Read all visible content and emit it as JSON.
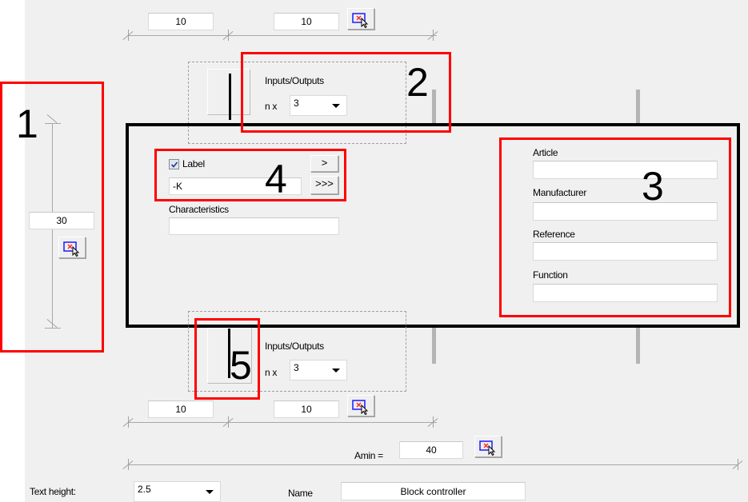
{
  "top_dimensions": {
    "left_value": "10",
    "right_value": "10"
  },
  "top_io": {
    "title": "Inputs/Outputs",
    "count_prefix": "n x",
    "count_value": "3"
  },
  "height_dimension": {
    "value": "30"
  },
  "label_section": {
    "checkbox_label": "Label",
    "checked": true,
    "label_value": "-K",
    "next_button": ">",
    "all_button": ">>>",
    "characteristics_label": "Characteristics",
    "characteristics_value": ""
  },
  "properties": {
    "article_label": "Article",
    "article_value": "",
    "manufacturer_label": "Manufacturer",
    "manufacturer_value": "",
    "reference_label": "Reference",
    "reference_value": "",
    "function_label": "Function",
    "function_value": ""
  },
  "bottom_io": {
    "title": "Inputs/Outputs",
    "count_prefix": "n x",
    "count_value": "3"
  },
  "bottom_dimensions": {
    "left_value": "10",
    "right_value": "10"
  },
  "amin": {
    "label": "Amin =",
    "value": "40"
  },
  "footer": {
    "text_height_label": "Text height:",
    "text_height_value": "2.5",
    "name_label": "Name",
    "name_value": "Block controller"
  },
  "annotations": {
    "callout_1": "1",
    "callout_2": "2",
    "callout_3": "3",
    "callout_4": "4",
    "callout_5": "5",
    "color": "#ff0000"
  },
  "icons": {
    "pick_button": "pick-from-drawing-icon",
    "io_preview": "io-bar-icon",
    "combo_arrow": "dropdown-arrow-icon",
    "check": "checkmark-icon"
  }
}
